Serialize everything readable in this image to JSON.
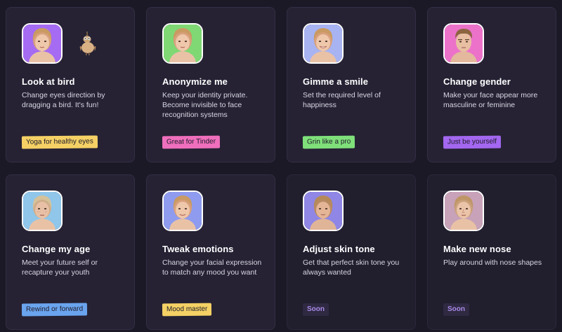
{
  "colors": {
    "background": "#1c1927",
    "card": "#262234",
    "tag_yellow": "#f5d165",
    "tag_pink": "#ef6fbd",
    "tag_green": "#7fe07a",
    "tag_purple": "#a367f0",
    "tag_blue": "#6aa4ee",
    "tag_soon_text": "#a98ae8"
  },
  "cards": [
    {
      "title": "Look at bird",
      "description": "Change eyes direction by dragging a bird. It's fun!",
      "tag": "Yoga for healthy eyes",
      "tag_color": "#f5d165",
      "avatar_bg": "#a56bf2",
      "icon": "bird-icon"
    },
    {
      "title": "Anonymize me",
      "description": "Keep your identity private. Become invisible to face recognition systems",
      "tag": "Great for Tinder",
      "tag_color": "#ef6fbd",
      "avatar_bg": "#7fd874"
    },
    {
      "title": "Gimme a smile",
      "description": "Set the required level of happiness",
      "tag": "Grin like a pro",
      "tag_color": "#7fe07a",
      "avatar_bg": "#a8b3f2"
    },
    {
      "title": "Change gender",
      "description": "Make your face appear more masculine or feminine",
      "tag": "Just be yourself",
      "tag_color": "#a367f0",
      "avatar_bg": "#ec72c9"
    },
    {
      "title": "Change my age",
      "description": "Meet your future self or recapture your youth",
      "tag": "Rewind or forward",
      "tag_color": "#6aa4ee",
      "avatar_bg": "#8fc6ea"
    },
    {
      "title": "Tweak emotions",
      "description": "Change your facial expression to match any mood you want",
      "tag": "Mood master",
      "tag_color": "#f5d165",
      "avatar_bg": "#8e9bef"
    },
    {
      "title": "Adjust skin tone",
      "description": "Get that perfect skin tone you always wanted",
      "tag": "Soon",
      "tag_color": "#2f2942",
      "avatar_bg": "#8f86e6"
    },
    {
      "title": "Make new nose",
      "description": "Play around with nose shapes",
      "tag": "Soon",
      "tag_color": "#2f2942",
      "avatar_bg": "#c7a2b8"
    }
  ]
}
